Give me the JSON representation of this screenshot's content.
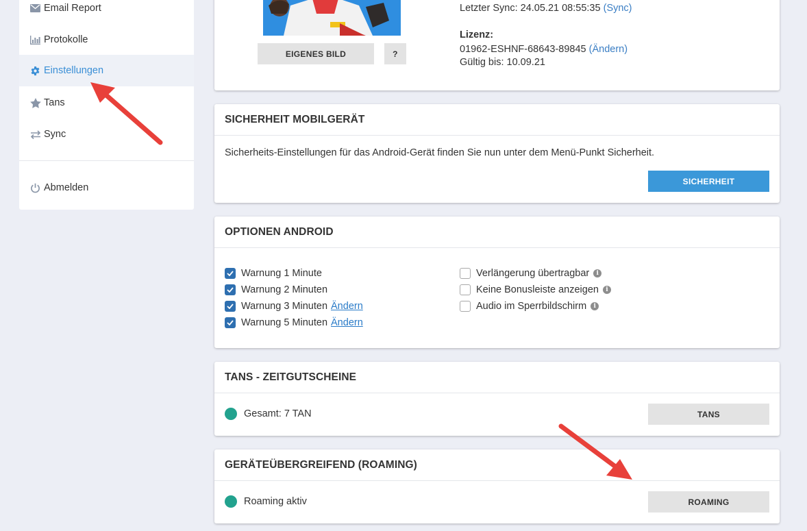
{
  "sidebar": {
    "items": [
      {
        "label": "Email Report",
        "icon": "envelope-icon"
      },
      {
        "label": "Protokolle",
        "icon": "bar-chart-icon"
      },
      {
        "label": "Einstellungen",
        "icon": "gear-icon",
        "active": true
      },
      {
        "label": "Tans",
        "icon": "star-icon"
      },
      {
        "label": "Sync",
        "icon": "sync-arrows-icon"
      }
    ],
    "logout": {
      "label": "Abmelden",
      "icon": "power-icon"
    }
  },
  "profile": {
    "own_image_button": "EIGENES BILD",
    "help_button": "?",
    "last_sync_label": "Letzter Sync: 24.05.21 08:55:35",
    "sync_link": "(Sync)",
    "license_heading": "Lizenz:",
    "license_key": "01962-ESHNF-68643-89845",
    "license_change_link": "(Ändern)",
    "valid_until": "Gültig bis: 10.09.21"
  },
  "security_card": {
    "title": "SICHERHEIT MOBILGERÄT",
    "text": "Sicherheits-Einstellungen für das Android-Gerät finden Sie nun unter dem Menü-Punkt Sicherheit.",
    "button": "SICHERHEIT"
  },
  "android_options": {
    "title": "OPTIONEN ANDROID",
    "left": [
      {
        "label": "Warnung 1 Minute",
        "checked": true
      },
      {
        "label": "Warnung 2 Minuten",
        "checked": true
      },
      {
        "label": "Warnung 3 Minuten",
        "checked": true,
        "link": "Ändern"
      },
      {
        "label": "Warnung 5 Minuten",
        "checked": true,
        "link": "Ändern"
      }
    ],
    "right": [
      {
        "label": "Verlängerung übertragbar",
        "checked": false
      },
      {
        "label": "Keine Bonusleiste anzeigen",
        "checked": false
      },
      {
        "label": "Audio im Sperrbildschirm",
        "checked": false
      }
    ]
  },
  "tans_card": {
    "title": "TANS - ZEITGUTSCHEINE",
    "status": "Gesamt: 7 TAN",
    "button": "TANS"
  },
  "roaming_card": {
    "title": "GERÄTEÜBERGREIFEND (ROAMING)",
    "status": "Roaming aktiv",
    "button": "ROAMING"
  },
  "colors": {
    "accent_blue": "#3b98d9",
    "status_green": "#22a28e",
    "annotation_red": "#e8403a"
  }
}
